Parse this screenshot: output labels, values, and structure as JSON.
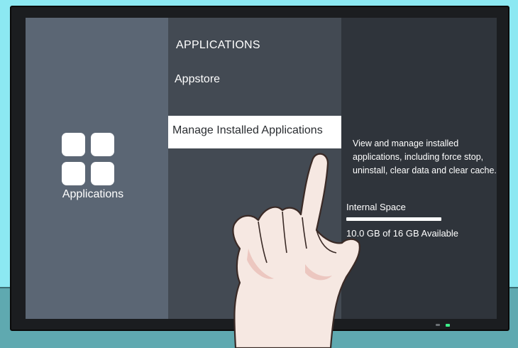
{
  "sidebar": {
    "app_label": "Applications",
    "icon": "app-grid-icon"
  },
  "menu": {
    "title": "APPLICATIONS",
    "items": [
      {
        "label": "Appstore",
        "selected": false
      },
      {
        "label": "Manage Installed Applications",
        "selected": true
      }
    ]
  },
  "details": {
    "description": "View and manage installed applications, including force stop, uninstall, clear data and clear cache.",
    "storage_label": "Internal Space",
    "storage_used_fraction": 1.0,
    "storage_text": "10.0 GB of 16 GB Available"
  },
  "colors": {
    "background": "#8ce8f2",
    "bezel": "#1b1d20",
    "left_pane": "#5b6674",
    "mid_pane": "#434a53",
    "right_pane": "#2f343b",
    "selected_item": "#ffffff",
    "indicator_led": "#3df08a"
  }
}
